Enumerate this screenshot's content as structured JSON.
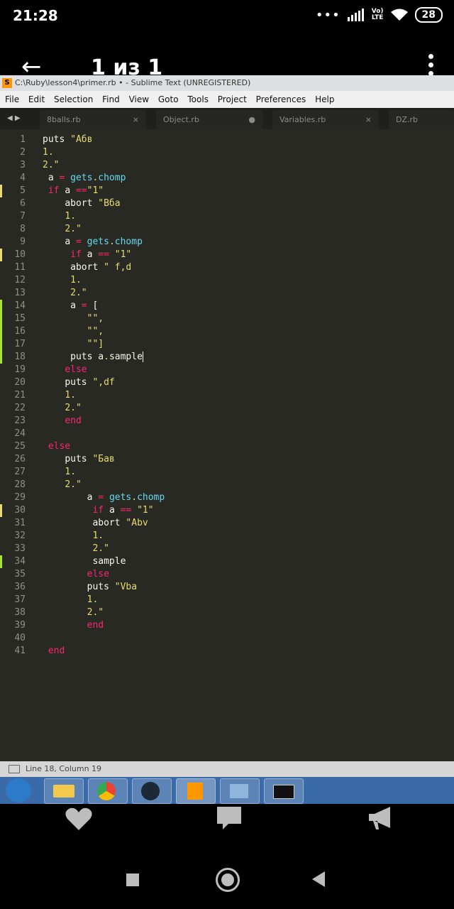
{
  "status": {
    "time": "21:28",
    "dots": "•••",
    "lte_top": "Vo)",
    "lte_bottom": "LTE",
    "battery": "28"
  },
  "viewer": {
    "back_icon": "←",
    "title": "1 из 1"
  },
  "window": {
    "title": "C:\\Ruby\\lesson4\\primer.rb • - Sublime Text (UNREGISTERED)"
  },
  "menu": [
    "File",
    "Edit",
    "Selection",
    "Find",
    "View",
    "Goto",
    "Tools",
    "Project",
    "Preferences",
    "Help"
  ],
  "tabs": [
    {
      "name": "8balls.rb",
      "close": "×"
    },
    {
      "name": "Object.rb",
      "close": "●"
    },
    {
      "name": "Variables.rb",
      "close": "×"
    },
    {
      "name": "DZ.rb",
      "close": ""
    }
  ],
  "tab_arrows": "◀ ▶",
  "code": [
    "puts \"Абв",
    "1.",
    "2.\"",
    " a = gets.chomp",
    " if a ==\"1\"",
    "    abort \"Вба",
    "    1.",
    "    2.\"",
    "    a = gets.chomp",
    "     if a == \"1\"",
    "     abort \" f,d",
    "     1.",
    "     2.\"",
    "     a = [",
    "        \"\",",
    "        \"\",",
    "        \"\"]",
    "     puts a.sample",
    "    else",
    "    puts \",df",
    "    1.",
    "    2.\"",
    "    end",
    "",
    " else",
    "    puts \"Бав",
    "    1.",
    "    2.\"",
    "        a = gets.chomp",
    "         if a == \"1\"",
    "         abort \"Abv",
    "         1.",
    "         2.\"",
    "         sample",
    "        else",
    "        puts \"Vba",
    "        1.",
    "        2.\"",
    "        end",
    "",
    " end"
  ],
  "line_marks": {
    "5": "#e6db74",
    "10": "#e6db74",
    "14": "#a6e22e",
    "15": "#a6e22e",
    "16": "#a6e22e",
    "17": "#a6e22e",
    "18": "#a6e22e",
    "30": "#e6db74",
    "34": "#a6e22e"
  },
  "cursor": "Line 18, Column 19",
  "action_icons": [
    "heart-icon",
    "comment-icon",
    "megaphone-icon"
  ]
}
